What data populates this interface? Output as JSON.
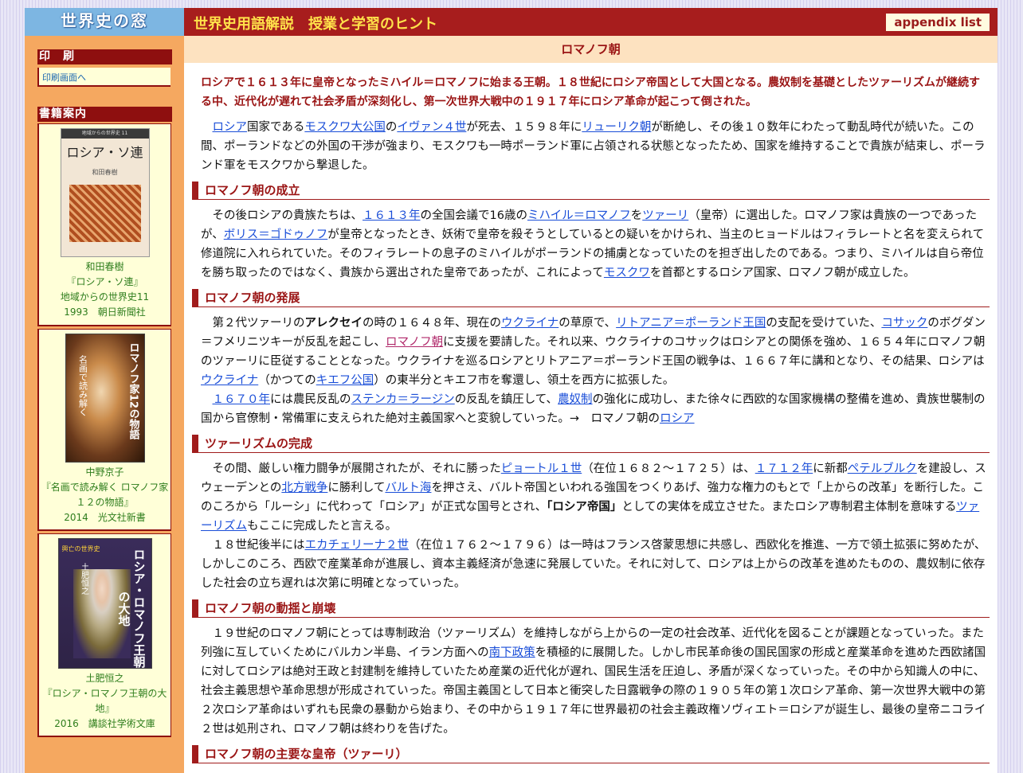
{
  "site": {
    "logo": "世界史の窓",
    "header_title": "世界史用語解説　授業と学習のヒント",
    "appendix": "appendix list"
  },
  "sidebar": {
    "print_title": "印　刷",
    "print_link": "印刷画面へ",
    "books_title": "書籍案内",
    "books": [
      {
        "cover_title": "ロシア・ソ連",
        "cover_band": "地域からの世界史 11",
        "cover_author": "和田春樹",
        "author": "和田春樹",
        "title": "『ロシア・ソ連』",
        "series": "地域からの世界史11",
        "pub": "1993　朝日新聞社"
      },
      {
        "cover_title": "ロマノフ家12の物語",
        "cover_band": "名画で読み解く",
        "author": "中野京子",
        "title": "『名画で読み解く ロマノフ家１２の物語』",
        "pub": "2014　光文社新書"
      },
      {
        "cover_title": "ロシア・ロマノフ王朝の大地",
        "cover_band": "興亡の世界史",
        "cover_author": "土肥恒之",
        "author": "土肥恒之",
        "title": "『ロシア・ロマノフ王朝の大地』",
        "pub": "2016　講談社学術文庫"
      }
    ]
  },
  "article": {
    "title": "ロマノフ朝",
    "lead": "ロシアで１６１３年に皇帝となったミハイル＝ロマノフに始まる王朝。１８世紀にロシア帝国として大国となる。農奴制を基礎としたツァーリズムが継続する中、近代化が遅れて社会矛盾が深刻化し、第一次世界大戦中の１９１７年にロシア革命が起こって倒された。",
    "p1": [
      "ロシア",
      "国家である",
      "モスクワ大公国",
      "の",
      "イヴァン４世",
      "が死去、１５９８年に",
      "リューリク朝",
      "が断絶し、その後１０数年にわたって動乱時代が続いた。この間、ポーランドなどの外国の干渉が強まり、モスクワも一時ポーランド軍に占領される状態となったため、国家を維持することで貴族が結束し、ポーランド軍をモスクワから撃退した。"
    ],
    "h_seiritsu": "ロマノフ朝の成立",
    "p2": [
      "その後ロシアの貴族たちは、",
      "１６１３年",
      "の全国会議で16歳の",
      "ミハイル＝ロマノフ",
      "を",
      "ツァーリ",
      "（皇帝）に選出した。ロマノフ家は貴族の一つであったが、",
      "ボリス＝ゴドゥノフ",
      "が皇帝となったとき、妖術で皇帝を殺そうとしているとの疑いをかけられ、当主のヒョードルはフィラレートと名を変えられて修道院に入れられていた。そのフィラレートの息子のミハイルがポーランドの捕虜となっていたのを担ぎ出したのである。つまり、ミハイルは自ら帝位を勝ち取ったのではなく、貴族から選出された皇帝であったが、これによって",
      "モスクワ",
      "を首都とするロシア国家、ロマノフ朝が成立した。"
    ],
    "h_hatten": "ロマノフ朝の発展",
    "p3": [
      "第２代ツァーリの",
      "アレクセイ",
      "の時の１６４８年、現在の",
      "ウクライナ",
      "の草原で、",
      "リトアニア＝ポーランド王国",
      "の支配を受けていた、",
      "コサック",
      "のボグダン＝フメリニツキーが反乱を起こし、",
      "ロマノフ朝",
      "に支援を要請した。それ以来、ウクライナのコサックはロシアとの関係を強め、１６５４年にロマノフ朝のツァーリに臣従することとなった。ウクライナを巡るロシアとリトアニア＝ポーランド王国の戦争は、１６６７年に講和となり、その結果、ロシアは",
      "ウクライナ",
      "（かつての",
      "キエフ公国",
      "）の東半分とキエフ市を奪還し、領土を西方に拡張した。"
    ],
    "p4": [
      "１６７０年",
      "には農民反乱の",
      "ステンカ＝ラージン",
      "の反乱を鎮圧して、",
      "農奴制",
      "の強化に成功し、また徐々に西欧的な国家機構の整備を進め、貴族世襲制の国から官僚制・常備軍に支えられた絶対主義国家へと変貌していった。→　ロマノフ朝の",
      "ロシア"
    ],
    "h_kansei": "ツァーリズムの完成",
    "p5": [
      "その間、厳しい権力闘争が展開されたが、それに勝った",
      "ピョートル１世",
      "（在位１６８２～１７２５）は、",
      "１７１２年",
      "に新都",
      "ペテルブルク",
      "を建設し、スウェーデンとの",
      "北方戦争",
      "に勝利して",
      "バルト海",
      "を押さえ、バルト帝国といわれる強国をつくりあげ、強力な権力のもとで「上からの改革」を断行した。このころから「ルーシ」に代わって「ロシア」が正式な国号とされ、",
      "「ロシア帝国」",
      "としての実体を成立させた。またロシア専制君主体制を意味する",
      "ツァーリズム",
      "もここに完成したと言える。"
    ],
    "p6": [
      "１８世紀後半には",
      "エカチェリーナ２世",
      "（在位１７６２～１７９６）は一時はフランス啓蒙思想に共感し、西欧化を推進、一方で領土拡張に努めたが、しかしこのころ、西欧で産業革命が進展し、資本主義経済が急速に発展していた。それに対して、ロシアは上からの改革を進めたものの、農奴制に依存した社会の立ち遅れは次第に明確となっていった。"
    ],
    "h_hokai": "ロマノフ朝の動揺と崩壊",
    "p7": [
      "１９世紀のロマノフ朝にとっては専制政治（ツァーリズム）を維持しながら上からの一定の社会改革、近代化を図ることが課題となっていった。また列強に互していくためにバルカン半島、イラン方面への",
      "南下政策",
      "を積極的に展開した。しかし市民革命後の国民国家の形成と産業革命を進めた西欧諸国に対してロシアは絶対王政と封建制を維持していたため産業の近代化が遅れ、国民生活を圧迫し、矛盾が深くなっていった。その中から知識人の中に、社会主義思想や革命思想が形成されていった。帝国主義国として日本と衝突した日露戦争の際の１９０５年の第１次ロシア革命、第一次世界大戦中の第２次ロシア革命はいずれも民衆の暴動から始まり、その中から１９１７年に世界最初の社会主義政権ソヴィエト＝ロシアが誕生し、最後の皇帝ニコライ２世は処刑され、ロマノフ朝は終わりを告げた。"
    ],
    "h_koutei": "ロマノフ朝の主要な皇帝（ツァーリ）"
  }
}
